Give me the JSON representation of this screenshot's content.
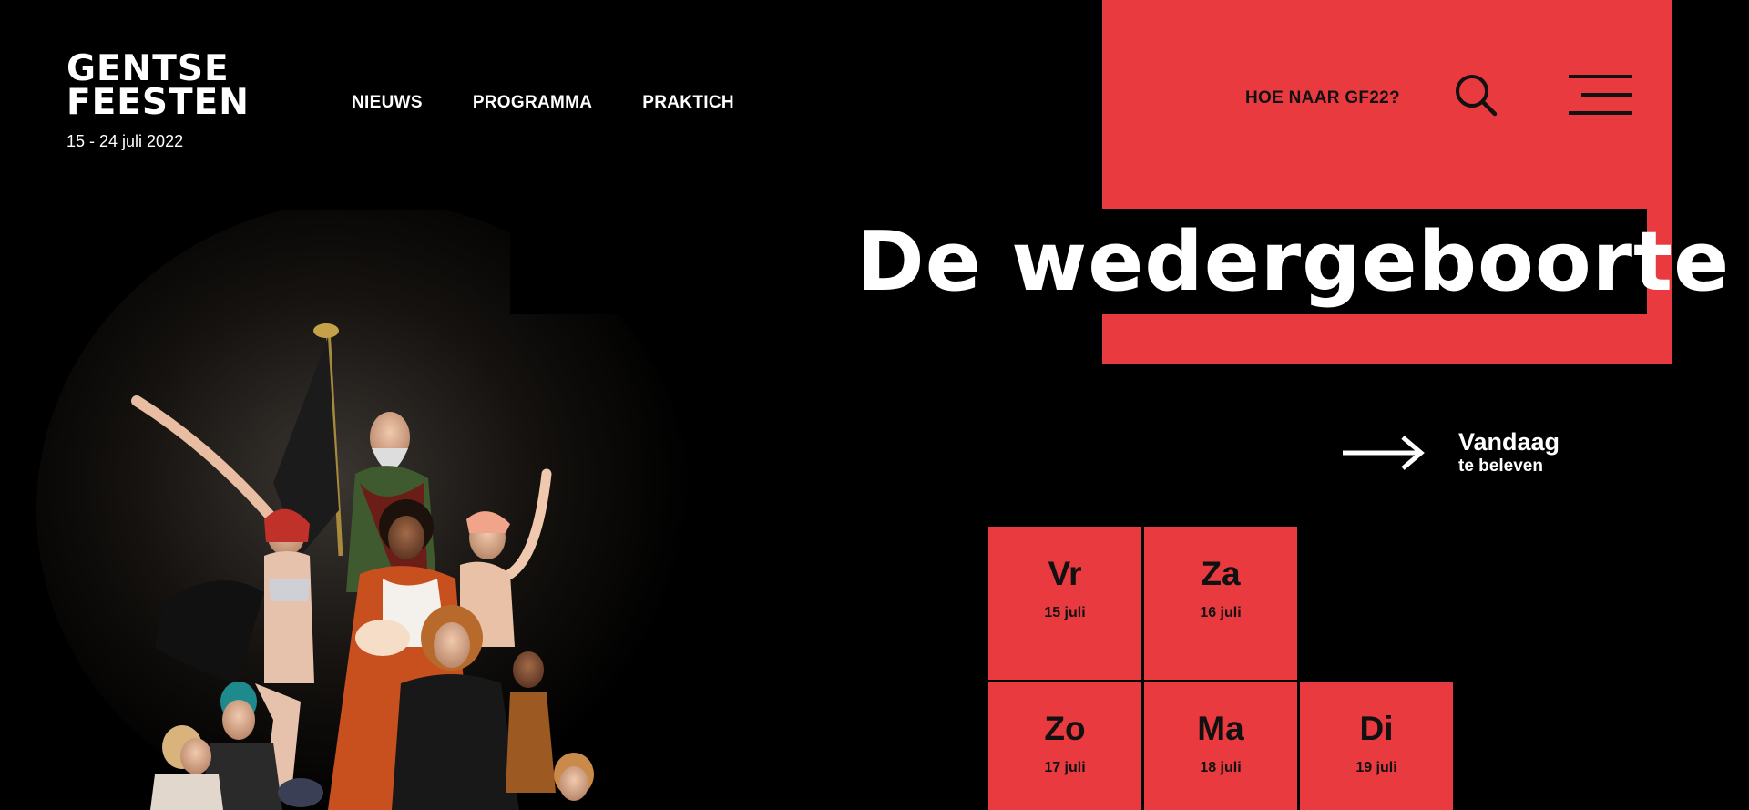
{
  "brand": {
    "logo_line1": "GENTSE",
    "logo_line2": "FEESTEN",
    "dates": "15 - 24 juli 2022"
  },
  "nav": {
    "items": [
      {
        "label": "NIEUWS"
      },
      {
        "label": "PROGRAMMA"
      },
      {
        "label": "PRAKTICH"
      }
    ]
  },
  "header_right": {
    "how_to_link": "HOE NAAR GF22?",
    "search_icon": "search-icon",
    "menu_icon": "hamburger-menu-icon"
  },
  "hero": {
    "headline": "De wedergeboorte"
  },
  "today_link": {
    "line1": "Vandaag",
    "line2": "te beleven",
    "icon": "arrow-right-icon"
  },
  "days": [
    {
      "name": "Vr",
      "date": "15 juli"
    },
    {
      "name": "Za",
      "date": "16 juli"
    },
    {
      "name": "Zo",
      "date": "17 juli"
    },
    {
      "name": "Ma",
      "date": "18 juli"
    },
    {
      "name": "Di",
      "date": "19 juli"
    }
  ],
  "colors": {
    "accent": "#e83a3f",
    "background": "#000000",
    "text_light": "#ffffff",
    "text_dark": "#111111"
  }
}
